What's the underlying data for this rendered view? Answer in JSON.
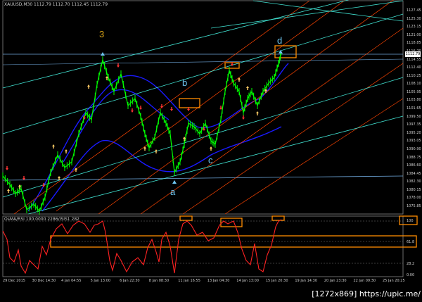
{
  "window": {
    "header": "XAUUSD,M30  1112.79  1112.70  1112.45  1112.79",
    "sub_header": "OsMA/RSI 100.0000 2286/ISIS1 282"
  },
  "wave_labels": {
    "w3": "3",
    "wb": "b",
    "wa": "a",
    "wc": "c",
    "wd": "d"
  },
  "colors": {
    "price": "#00ff00",
    "oscillator": "#ff2222",
    "channel": "#ff4500",
    "trend": "#40e0d0",
    "band": "#1a1aff",
    "box": "#ff8c00",
    "label_gold": "#d4a017",
    "label_cyan": "#6ec6f0"
  },
  "price_axis": [
    "1127.45",
    "1125.30",
    "1123.15",
    "1121.00",
    "1118.85",
    "1116.70",
    "1114.55",
    "1112.40",
    "1110.25",
    "1108.10",
    "1105.95",
    "1103.80",
    "1101.65",
    "1099.50",
    "1097.35",
    "1095.20",
    "1093.05",
    "1090.90",
    "1088.75",
    "1086.60",
    "1084.45",
    "1082.30",
    "1080.15",
    "1078.00",
    "1075.85"
  ],
  "current_price": "1112.79",
  "oscillator_axis": [
    "100",
    "61.8",
    "28.2",
    "0.00"
  ],
  "time_axis": [
    "29 Dec 2015",
    "30 Dec 14:30",
    "4 Jan 04:55",
    "5 Jan 13:00",
    "6 Jan 22:30",
    "8 Jan 08:30",
    "11 Jan 16:55",
    "13 Jan 04:30",
    "14 Jan 13:00",
    "15 Jan 20:30",
    "19 Jan 14:30",
    "20 Jan 23:30",
    "22 Jan 09:30",
    "25 Jan 20:25"
  ],
  "watermark": "[1272x869] https://upic.me/"
}
